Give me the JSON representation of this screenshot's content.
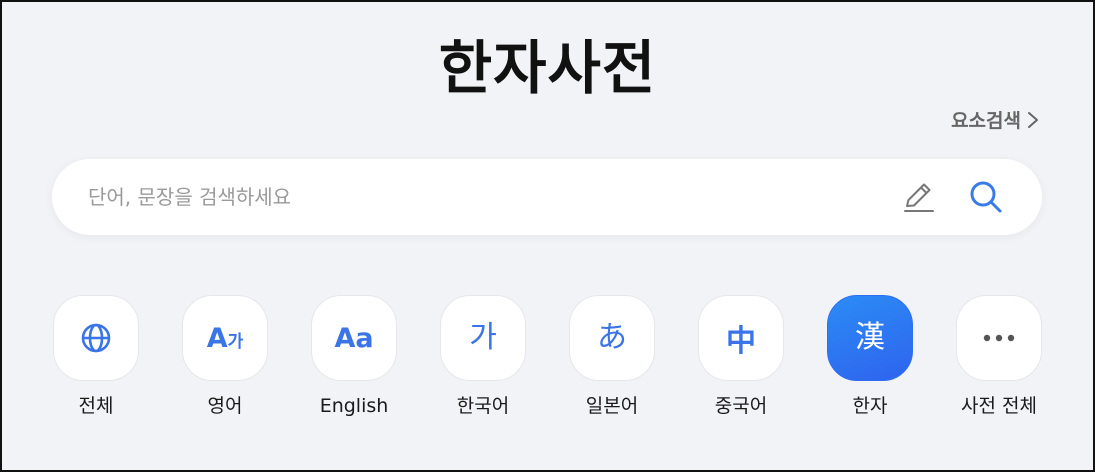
{
  "header": {
    "title": "한자사전",
    "element_search_label": "요소검색"
  },
  "search": {
    "placeholder": "단어, 문장을 검색하세요",
    "value": ""
  },
  "categories": [
    {
      "label": "전체",
      "icon": "globe-icon"
    },
    {
      "label": "영어",
      "icon_text": "A",
      "icon_sub": "가"
    },
    {
      "label": "English",
      "icon_text": "Aa"
    },
    {
      "label": "한국어",
      "icon_text": "가"
    },
    {
      "label": "일본어",
      "icon_text": "あ"
    },
    {
      "label": "중국어",
      "icon_text": "中"
    },
    {
      "label": "한자",
      "icon_text": "漢",
      "active": true
    },
    {
      "label": "사전 전체",
      "icon": "more-icon"
    }
  ],
  "colors": {
    "accent": "#3b74e6",
    "active_tile": "#2f6cf0",
    "background": "#f2f3f7"
  }
}
